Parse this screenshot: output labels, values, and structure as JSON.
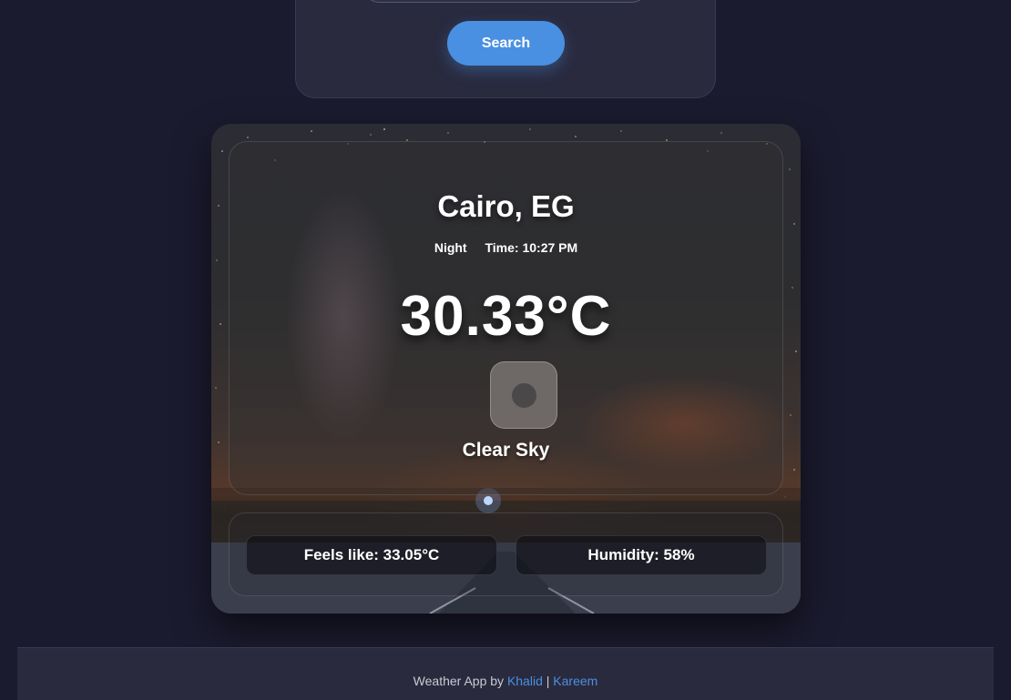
{
  "search": {
    "input_value": "",
    "button_label": "Search"
  },
  "weather": {
    "city": "Cairo, EG",
    "period": "Night",
    "time": "Time: 10:27 PM",
    "temperature": "30.33°C",
    "icon": "weather-icon",
    "condition": "Clear Sky",
    "feels_like": "Feels like: 33.05°C",
    "humidity": "Humidity: 58%"
  },
  "footer": {
    "prefix": "Weather App by",
    "author1": "Khalid",
    "separator": "|",
    "author2": "Kareem"
  },
  "colors": {
    "background": "#1b1b2f",
    "card": "#292a3e",
    "accent": "#4a90e2",
    "text": "#ffffff"
  }
}
